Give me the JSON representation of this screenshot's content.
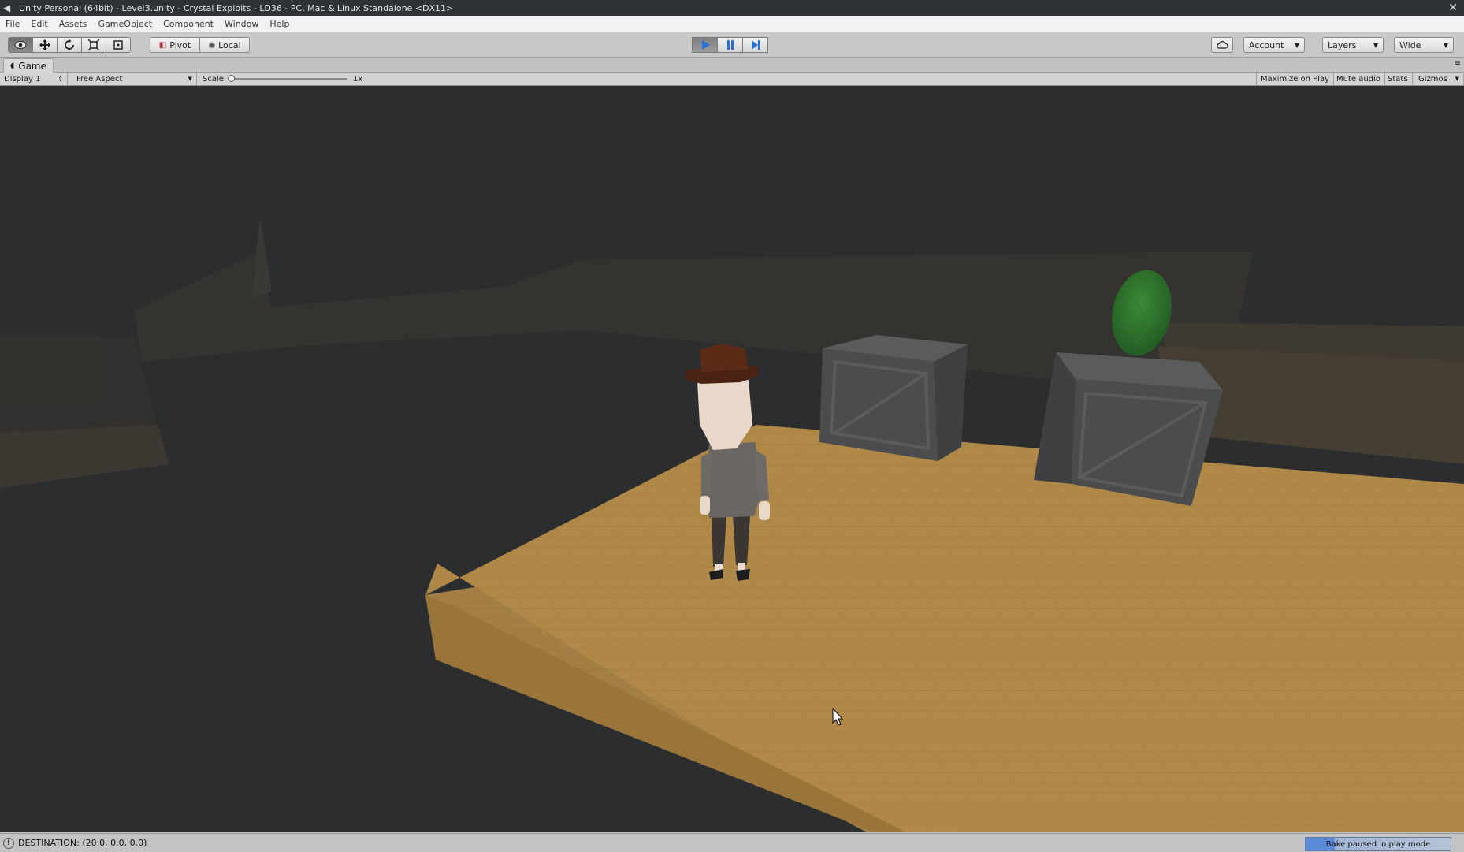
{
  "window": {
    "title": "Unity Personal (64bit) - Level3.unity - Crystal Exploits - LD36 - PC, Mac & Linux Standalone <DX11>"
  },
  "menubar": {
    "items": [
      "File",
      "Edit",
      "Assets",
      "GameObject",
      "Component",
      "Window",
      "Help"
    ]
  },
  "toolbar": {
    "tools": [
      {
        "name": "view-tool",
        "icon": "eye-icon"
      },
      {
        "name": "move-tool",
        "icon": "move-arrows-icon"
      },
      {
        "name": "rotate-tool",
        "icon": "rotate-icon"
      },
      {
        "name": "scale-tool",
        "icon": "scale-icon"
      },
      {
        "name": "rect-tool",
        "icon": "rect-icon"
      }
    ],
    "active_tool": "view-tool",
    "pivot_label": "Pivot",
    "local_label": "Local",
    "play_state": "playing",
    "account_label": "Account",
    "layers_label": "Layers",
    "layout_label": "Wide"
  },
  "game_view": {
    "tab_label": "Game",
    "display_label": "Display 1",
    "aspect_label": "Free Aspect",
    "scale_label": "Scale",
    "scale_value": "1x",
    "maximize_label": "Maximize on Play",
    "mute_label": "Mute audio",
    "stats_label": "Stats",
    "gizmos_label": "Gizmos"
  },
  "statusbar": {
    "message": "DESTINATION: (20.0, 0.0, 0.0)",
    "bake_status": "Bake paused in play mode"
  },
  "colors": {
    "viewport_bg": "#2c2d2f",
    "floor": "#b08848",
    "crate": "#4e4f50",
    "crystal": "#2c6f2a",
    "play_accent": "#2a6fd6"
  }
}
